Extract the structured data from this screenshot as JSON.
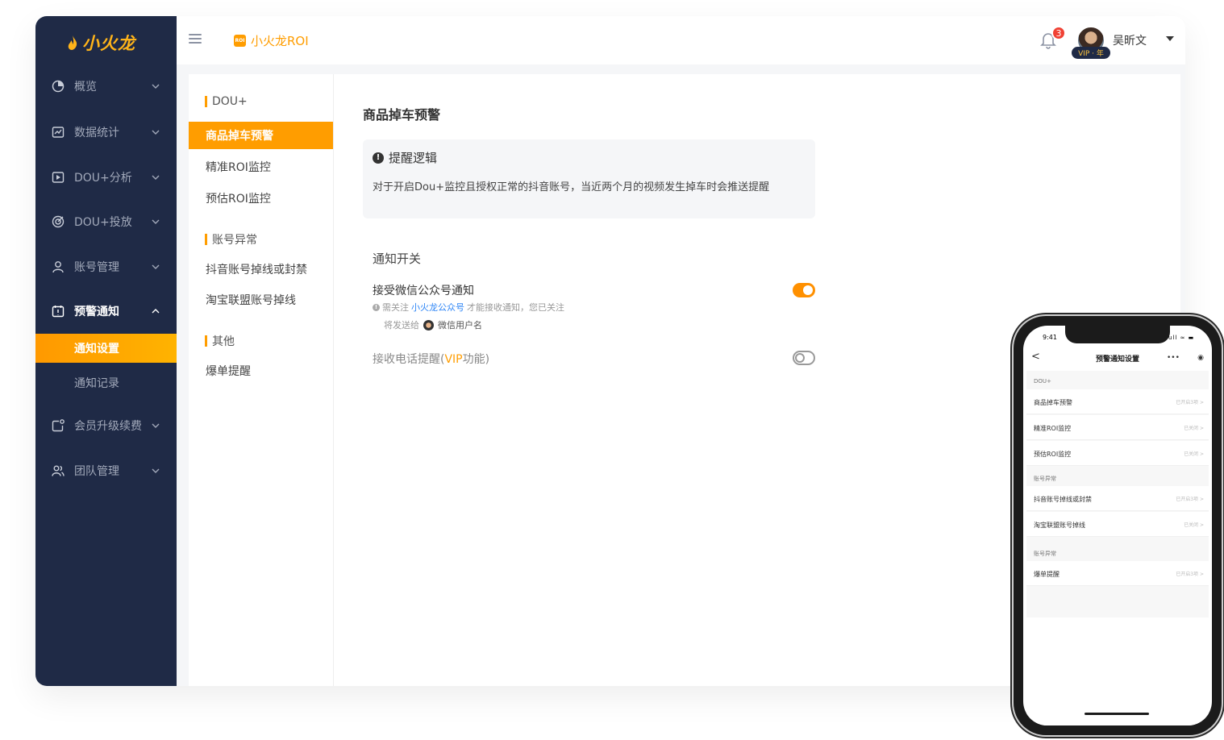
{
  "app": {
    "logo_text": "小火龙",
    "brand_badge": "ROI",
    "brand_name": "小火龙ROI"
  },
  "colors": {
    "accent": "#ff9d00",
    "sidebar_bg": "#1f2a46",
    "link": "#2f86f6",
    "badge_red": "#f04134"
  },
  "topbar": {
    "notification_count": "3",
    "user_name": "吴昕文",
    "vip_label": "VIP · 年"
  },
  "sidebar": {
    "items": [
      {
        "label": "概览",
        "icon": "pie-chart-icon"
      },
      {
        "label": "数据统计",
        "icon": "line-chart-icon"
      },
      {
        "label": "DOU+分析",
        "icon": "play-icon"
      },
      {
        "label": "DOU+投放",
        "icon": "target-icon"
      },
      {
        "label": "账号管理",
        "icon": "user-icon"
      },
      {
        "label": "预警通知",
        "icon": "calendar-alert-icon",
        "open": true
      },
      {
        "label": "会员升级续费",
        "icon": "membership-icon"
      },
      {
        "label": "团队管理",
        "icon": "team-icon"
      }
    ],
    "subitems": [
      {
        "label": "通知设置",
        "active": true
      },
      {
        "label": "通知记录"
      }
    ]
  },
  "subnav": {
    "groups": [
      {
        "label": "DOU+",
        "items": [
          "商品掉车预警",
          "精准ROI监控",
          "预估ROI监控"
        ]
      },
      {
        "label": "账号异常",
        "items": [
          "抖音账号掉线或封禁",
          "淘宝联盟账号掉线"
        ]
      },
      {
        "label": "其他",
        "items": [
          "爆单提醒"
        ]
      }
    ],
    "active_item": "商品掉车预警"
  },
  "main": {
    "title": "商品掉车预警",
    "logic_title": "提醒逻辑",
    "logic_text": "对于开启Dou+监控且授权正常的抖音账号，当近两个月的视频发生掉车时会推送提醒",
    "section_title": "通知开关",
    "wechat_label": "接受微信公众号通知",
    "wechat_enabled": true,
    "hint_prefix": "需关注",
    "hint_link": "小火龙公众号",
    "hint_suffix": "才能接收通知，您已关注",
    "sendto_label": "将发送给",
    "wechat_user": "微信用户名",
    "phone_label_prefix": "接收电话提醒(",
    "phone_label_vip": "VIP",
    "phone_label_suffix": "功能)",
    "phone_enabled": false
  },
  "phone": {
    "time": "9:41",
    "status": "ull ≈ ▬",
    "back": "<",
    "title": "预警通知设置",
    "menu_dots": "•••",
    "menu_target": "◉",
    "groups": [
      {
        "label": "DOU+",
        "rows": [
          {
            "title": "商品掉车预警",
            "status": "已开启3项 >"
          },
          {
            "title": "精准ROI监控",
            "status": "已关闭 >"
          },
          {
            "title": "预估ROI监控",
            "status": "已关闭 >"
          }
        ]
      },
      {
        "label": "账号异常",
        "rows": [
          {
            "title": "抖音账号掉线或封禁",
            "status": "已开启3项 >"
          },
          {
            "title": "淘宝联盟账号掉线",
            "status": "已关闭 >"
          }
        ]
      },
      {
        "label": "账号异常",
        "rows": [
          {
            "title": "爆单提醒",
            "status": "已开启3项 >"
          }
        ]
      }
    ]
  }
}
